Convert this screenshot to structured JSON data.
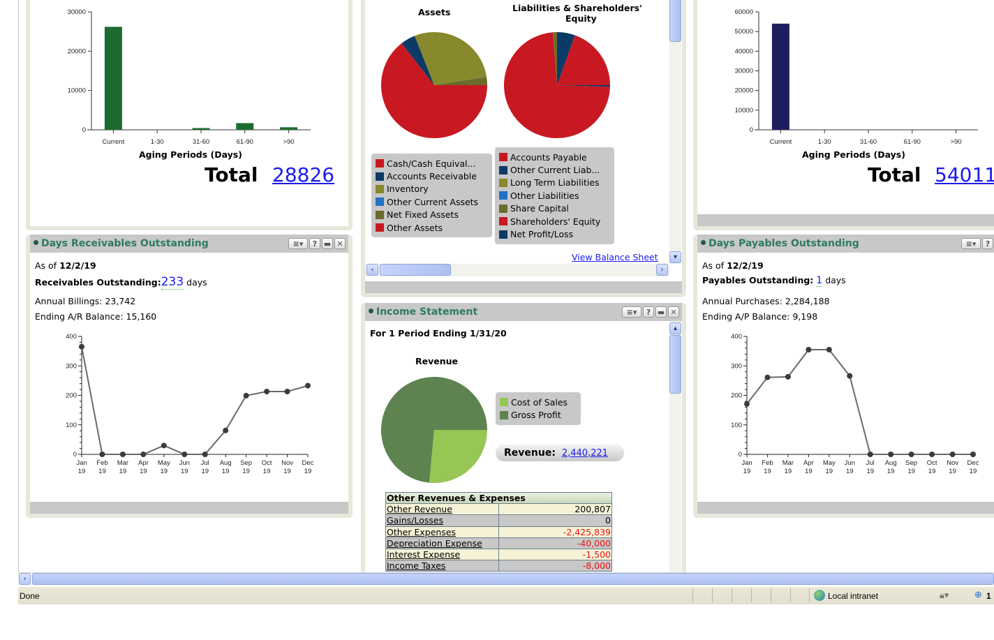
{
  "ar_aging": {
    "total_label": "Total",
    "total_value": "28826",
    "chart_data": {
      "type": "bar",
      "title": "",
      "xlabel": "Aging Periods (Days)",
      "ylabel": "",
      "categories": [
        "Current",
        "1-30",
        "31-60",
        "61-90",
        ">90"
      ],
      "values": [
        26200,
        0,
        450,
        1700,
        650
      ],
      "ylim": [
        0,
        30000
      ],
      "yticks": [
        0,
        10000,
        20000,
        30000
      ],
      "color": "#1e6b30"
    }
  },
  "balance_sheet": {
    "assets_title": "Assets",
    "liab_title_line1": "Liabilities & Shareholders'",
    "liab_title_line2": "Equity",
    "view_link": "View Balance Sheet",
    "chart_data": [
      {
        "type": "pie",
        "title": "Assets",
        "labels": [
          "Cash/Cash Equival...",
          "Accounts Receivable",
          "Inventory",
          "Other Current Assets",
          "Net Fixed Assets",
          "Other Assets"
        ],
        "values": [
          64.5,
          4.5,
          28.5,
          0,
          2.5,
          0
        ],
        "colors": [
          "#c81822",
          "#0b3a66",
          "#88882c",
          "#1e72c4",
          "#6b6b2c",
          "#c81822"
        ]
      },
      {
        "type": "pie",
        "title": "Liabilities & Shareholders' Equity",
        "labels": [
          "Accounts Payable",
          "Other Current Liab...",
          "Long Term Liabilities",
          "Other Liabilities",
          "Share Capital",
          "Shareholders' Equity",
          "Net Profit/Loss"
        ],
        "values": [
          19.5,
          5.5,
          0,
          0,
          1.3,
          73.2,
          0.5
        ],
        "colors": [
          "#c81822",
          "#0b3a66",
          "#88882c",
          "#1e72c4",
          "#6b6b2c",
          "#c81822",
          "#0b3a66"
        ]
      }
    ]
  },
  "ap_aging": {
    "total_label": "Total",
    "total_value": "54011",
    "chart_data": {
      "type": "bar",
      "title": "",
      "xlabel": "Aging Periods (Days)",
      "ylabel": "",
      "categories": [
        "Current",
        "1-30",
        "31-60",
        "61-90",
        ">90"
      ],
      "values": [
        54011,
        0,
        0,
        0,
        0
      ],
      "ylim": [
        0,
        60000
      ],
      "yticks": [
        0,
        10000,
        20000,
        30000,
        40000,
        50000,
        60000
      ],
      "color": "#1e1e5e"
    }
  },
  "dso": {
    "title": "Days Receivables Outstanding",
    "as_of_label": "As of",
    "as_of_date": "12/2/19",
    "metric_label": "Receivables Outstanding:",
    "metric_value": "233",
    "metric_unit": "days",
    "line1": "Annual Billings: 23,742",
    "line2": "Ending A/R Balance: 15,160",
    "chart_data": {
      "type": "line",
      "categories": [
        "Jan 19",
        "Feb 19",
        "Mar 19",
        "Apr 19",
        "May 19",
        "Jun 19",
        "Jul 19",
        "Aug 19",
        "Sep 19",
        "Oct 19",
        "Nov 19",
        "Dec 19"
      ],
      "values": [
        365,
        0,
        0,
        0,
        30,
        0,
        0,
        81,
        199,
        213,
        213,
        233
      ],
      "ylim": [
        0,
        400
      ],
      "yticks": [
        0,
        100,
        200,
        300,
        400
      ]
    }
  },
  "dpo": {
    "title": "Days Payables Outstanding",
    "as_of_label": "As of",
    "as_of_date": "12/2/19",
    "metric_label": "Payables Outstanding:",
    "metric_value": "1",
    "metric_unit": "days",
    "line1": "Annual Purchases: 2,284,188",
    "line2": "Ending A/P Balance: 9,198",
    "chart_data": {
      "type": "line",
      "categories": [
        "Jan 19",
        "Feb 19",
        "Mar 19",
        "Apr 19",
        "May 19",
        "Jun 19",
        "Jul 19",
        "Aug 19",
        "Sep 19",
        "Oct 19",
        "Nov 19",
        "Dec 19"
      ],
      "values": [
        171,
        261,
        263,
        355,
        355,
        266,
        0,
        0,
        0,
        0,
        0,
        0
      ],
      "ylim": [
        0,
        400
      ],
      "yticks": [
        0,
        100,
        200,
        300,
        400
      ]
    }
  },
  "income": {
    "title": "Income Statement",
    "period": "For 1 Period Ending 1/31/20",
    "revenue_title": "Revenue",
    "revenue_label": "Revenue:",
    "revenue_value": "2,440,221",
    "chart_data": {
      "type": "pie",
      "title": "Revenue",
      "labels": [
        "Cost of Sales",
        "Gross Profit"
      ],
      "values": [
        26.5,
        73.5
      ],
      "colors": [
        "#98c655",
        "#5e8350"
      ]
    },
    "table": {
      "header": "Other Revenues & Expenses",
      "rows": [
        {
          "name": "Other Revenue",
          "value": "200,807",
          "negative": false
        },
        {
          "name": "Gains/Losses",
          "value": "0",
          "negative": false
        },
        {
          "name": "Other Expenses",
          "value": "-2,425,839",
          "negative": true
        },
        {
          "name": "Depreciation Expense",
          "value": "-40,000",
          "negative": true
        },
        {
          "name": "Interest Expense",
          "value": "-1,500",
          "negative": true
        },
        {
          "name": "Income Taxes",
          "value": "-8,000",
          "negative": true
        }
      ]
    }
  },
  "buttons": {
    "menu": "≡▾",
    "help": "?",
    "minimize": "▬",
    "close": "✕"
  },
  "statusbar": {
    "status": "Done",
    "zone": "Local intranet",
    "zoom": "1"
  }
}
